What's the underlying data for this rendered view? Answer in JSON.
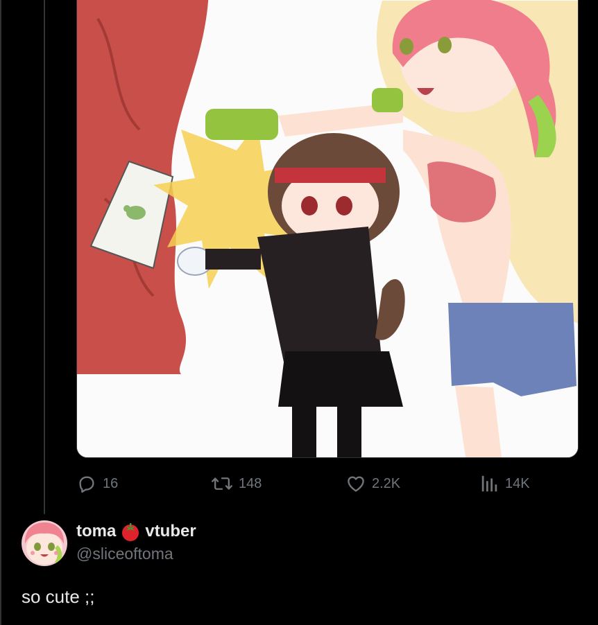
{
  "post": {
    "stats": {
      "replies": "16",
      "reposts": "148",
      "likes": "2.2K",
      "views": "14K"
    },
    "icons": {
      "reply": "reply-bubble-icon",
      "repost": "repost-arrows-icon",
      "like": "heart-icon",
      "views": "views-bars-icon"
    }
  },
  "reply": {
    "display_name_part1": "toma",
    "display_name_emoji": "tomato-emoji",
    "display_name_part2": "vtuber",
    "handle": "@sliceoftoma",
    "text": "so cute ;;"
  },
  "colors": {
    "background": "#000000",
    "primary_text": "#e7e9ea",
    "secondary_text": "#71767b",
    "divider": "#2f3336"
  }
}
